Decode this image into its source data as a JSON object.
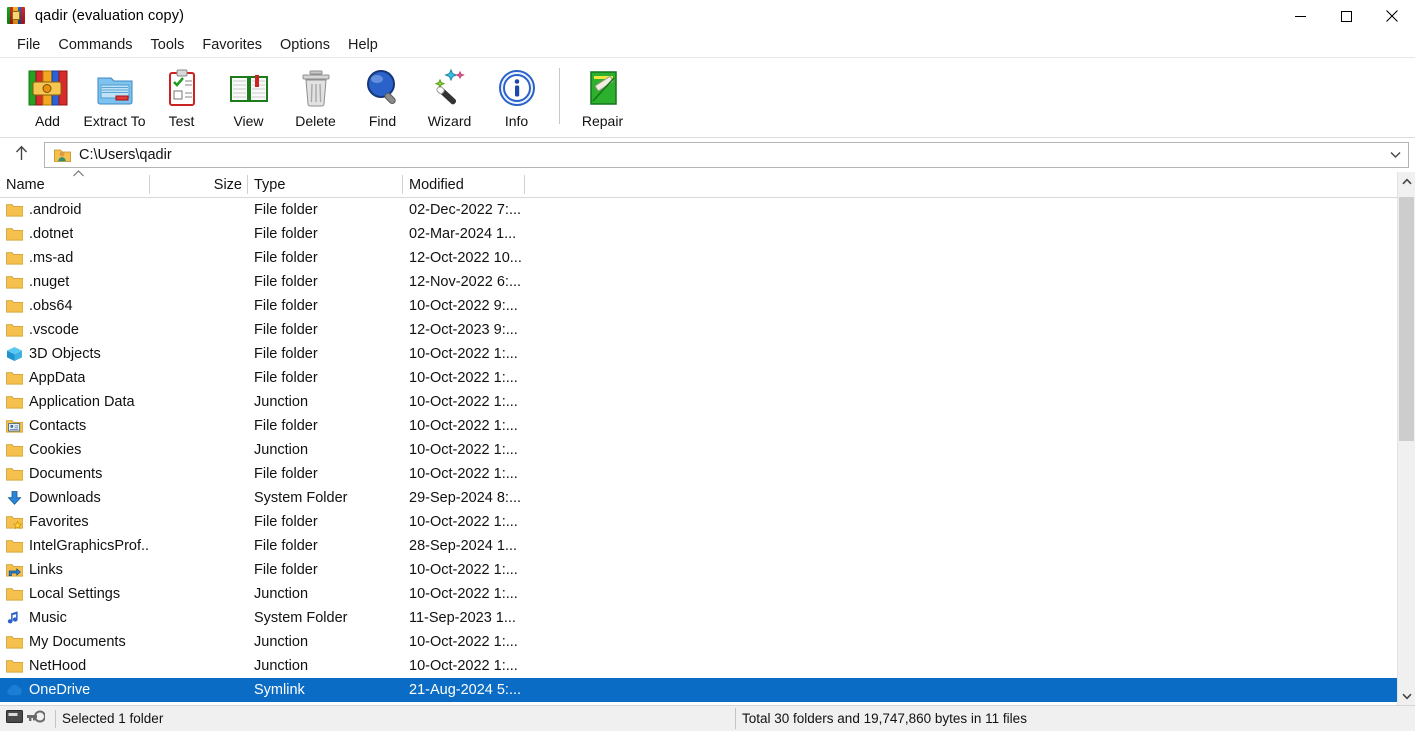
{
  "window": {
    "title": "qadir (evaluation copy)",
    "app_icon": "winrar-logo-icon",
    "minimize_label": "Minimize",
    "maximize_label": "Maximize",
    "close_label": "Close"
  },
  "menu": {
    "items": [
      {
        "label": "File"
      },
      {
        "label": "Commands"
      },
      {
        "label": "Tools"
      },
      {
        "label": "Favorites"
      },
      {
        "label": "Options"
      },
      {
        "label": "Help"
      }
    ]
  },
  "toolbar": {
    "buttons": [
      {
        "label": "Add",
        "icon": "add-archive-icon"
      },
      {
        "label": "Extract To",
        "icon": "extract-folder-icon"
      },
      {
        "label": "Test",
        "icon": "test-clipboard-icon"
      },
      {
        "label": "View",
        "icon": "view-book-icon"
      },
      {
        "label": "Delete",
        "icon": "delete-trash-icon"
      },
      {
        "label": "Find",
        "icon": "find-magnifier-icon"
      },
      {
        "label": "Wizard",
        "icon": "wizard-wand-icon"
      },
      {
        "label": "Info",
        "icon": "info-circle-icon"
      },
      {
        "label": "Repair",
        "icon": "repair-icon"
      }
    ],
    "separator_before": "Repair"
  },
  "address_bar": {
    "up_icon": "arrow-up-icon",
    "folder_icon": "user-folder-icon",
    "path": "C:\\Users\\qadir",
    "placeholder": "C:\\Users\\qadir",
    "dropdown_icon": "chevron-down-icon"
  },
  "columns": [
    {
      "key": "name",
      "label": "Name",
      "sorted": true,
      "sort_direction": "asc"
    },
    {
      "key": "size",
      "label": "Size"
    },
    {
      "key": "type",
      "label": "Type"
    },
    {
      "key": "modified",
      "label": "Modified"
    }
  ],
  "files": [
    {
      "name": ".android",
      "size": "",
      "type": "File folder",
      "modified": "02-Dec-2022 7:...",
      "icon": "folder-icon",
      "selected": false
    },
    {
      "name": ".dotnet",
      "size": "",
      "type": "File folder",
      "modified": "02-Mar-2024 1...",
      "icon": "folder-icon",
      "selected": false
    },
    {
      "name": ".ms-ad",
      "size": "",
      "type": "File folder",
      "modified": "12-Oct-2022 10...",
      "icon": "folder-icon",
      "selected": false
    },
    {
      "name": ".nuget",
      "size": "",
      "type": "File folder",
      "modified": "12-Nov-2022 6:...",
      "icon": "folder-icon",
      "selected": false
    },
    {
      "name": ".obs64",
      "size": "",
      "type": "File folder",
      "modified": "10-Oct-2022 9:...",
      "icon": "folder-icon",
      "selected": false
    },
    {
      "name": ".vscode",
      "size": "",
      "type": "File folder",
      "modified": "12-Oct-2023 9:...",
      "icon": "folder-icon",
      "selected": false
    },
    {
      "name": "3D Objects",
      "size": "",
      "type": "File folder",
      "modified": "10-Oct-2022 1:...",
      "icon": "3d-objects-icon",
      "selected": false
    },
    {
      "name": "AppData",
      "size": "",
      "type": "File folder",
      "modified": "10-Oct-2022 1:...",
      "icon": "folder-icon",
      "selected": false
    },
    {
      "name": "Application Data",
      "size": "",
      "type": "Junction",
      "modified": "10-Oct-2022 1:...",
      "icon": "folder-icon",
      "selected": false
    },
    {
      "name": "Contacts",
      "size": "",
      "type": "File folder",
      "modified": "10-Oct-2022 1:...",
      "icon": "contacts-card-icon",
      "selected": false
    },
    {
      "name": "Cookies",
      "size": "",
      "type": "Junction",
      "modified": "10-Oct-2022 1:...",
      "icon": "folder-icon",
      "selected": false
    },
    {
      "name": "Documents",
      "size": "",
      "type": "File folder",
      "modified": "10-Oct-2022 1:...",
      "icon": "folder-icon",
      "selected": false
    },
    {
      "name": "Downloads",
      "size": "",
      "type": "System Folder",
      "modified": "29-Sep-2024 8:...",
      "icon": "downloads-arrow-icon",
      "selected": false
    },
    {
      "name": "Favorites",
      "size": "",
      "type": "File folder",
      "modified": "10-Oct-2022 1:...",
      "icon": "favorites-star-icon",
      "selected": false
    },
    {
      "name": "IntelGraphicsProf...",
      "size": "",
      "type": "File folder",
      "modified": "28-Sep-2024 1...",
      "icon": "folder-icon",
      "selected": false
    },
    {
      "name": "Links",
      "size": "",
      "type": "File folder",
      "modified": "10-Oct-2022 1:...",
      "icon": "links-shortcut-icon",
      "selected": false
    },
    {
      "name": "Local Settings",
      "size": "",
      "type": "Junction",
      "modified": "10-Oct-2022 1:...",
      "icon": "folder-icon",
      "selected": false
    },
    {
      "name": "Music",
      "size": "",
      "type": "System Folder",
      "modified": "11-Sep-2023 1...",
      "icon": "music-note-icon",
      "selected": false
    },
    {
      "name": "My Documents",
      "size": "",
      "type": "Junction",
      "modified": "10-Oct-2022 1:...",
      "icon": "folder-icon",
      "selected": false
    },
    {
      "name": "NetHood",
      "size": "",
      "type": "Junction",
      "modified": "10-Oct-2022 1:...",
      "icon": "folder-icon",
      "selected": false
    },
    {
      "name": "OneDrive",
      "size": "",
      "type": "Symlink",
      "modified": "21-Aug-2024 5:...",
      "icon": "onedrive-cloud-icon",
      "selected": true
    }
  ],
  "scrollbar": {
    "up_icon": "chevron-up-icon",
    "down_icon": "chevron-down-icon",
    "thumb_top_pct": 1.5,
    "thumb_height_pct": 49
  },
  "status_bar": {
    "drive_icon": "drive-icon",
    "key_icon": "key-icon",
    "left_text": "Selected 1 folder",
    "right_text": "Total 30 folders and 19,747,860 bytes in 11 files"
  },
  "colors": {
    "selection": "#0a6cc4",
    "folder": "#f5c14e",
    "window_bg": "#ffffff",
    "status_bg": "#f0f0f0"
  }
}
